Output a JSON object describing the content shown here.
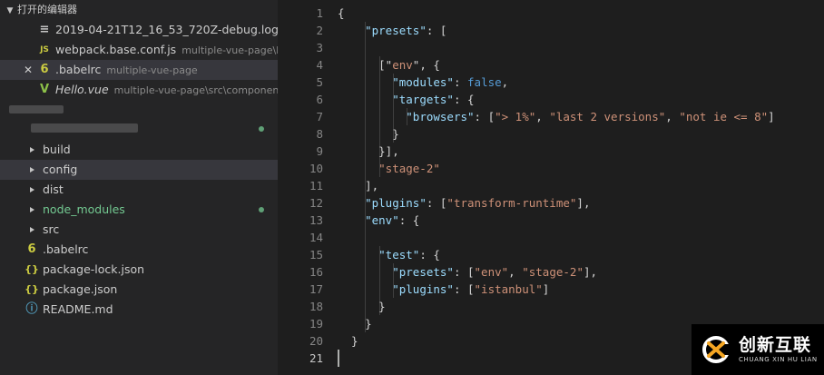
{
  "sidebar": {
    "open_editors_title": "打开的编辑器",
    "open_editors": [
      {
        "icon": "≡",
        "icon_color": "#c5c5c5",
        "name": "2019-04-21T12_16_53_720Z-debug.log",
        "desc": ""
      },
      {
        "icon": "JS",
        "icon_color": "#cbcb41",
        "name": "webpack.base.conf.js",
        "desc": "multiple-vue-page\\b..."
      },
      {
        "icon": "6",
        "icon_color": "#cbcb41",
        "name": ".babelrc",
        "desc": "multiple-vue-page",
        "close": "✕"
      },
      {
        "icon": "V",
        "icon_color": "#8dc149",
        "name": "Hello.vue",
        "desc": "multiple-vue-page\\src\\components"
      }
    ],
    "tree": [
      {
        "name": "build",
        "kind": "folder",
        "color": "#cccccc"
      },
      {
        "name": "config",
        "kind": "folder",
        "color": "#cccccc"
      },
      {
        "name": "dist",
        "kind": "folder",
        "color": "#cccccc"
      },
      {
        "name": "node_modules",
        "kind": "folder",
        "color": "#73c991"
      },
      {
        "name": "src",
        "kind": "folder",
        "color": "#cccccc"
      },
      {
        "name": ".babelrc",
        "kind": "file",
        "icon": "6",
        "icon_color": "#cbcb41",
        "color": "#cccccc"
      },
      {
        "name": "package-lock.json",
        "kind": "file",
        "icon": "{}",
        "icon_color": "#cbcb41",
        "color": "#cccccc"
      },
      {
        "name": "package.json",
        "kind": "file",
        "icon": "{}",
        "icon_color": "#cbcb41",
        "color": "#cccccc"
      },
      {
        "name": "README.md",
        "kind": "file",
        "icon": "ⓘ",
        "icon_color": "#519aba",
        "color": "#cccccc"
      }
    ]
  },
  "editor": {
    "line_numbers": [
      "1",
      "2",
      "3",
      "4",
      "5",
      "6",
      "7",
      "8",
      "9",
      "10",
      "11",
      "12",
      "13",
      "14",
      "15",
      "16",
      "17",
      "18",
      "19",
      "20",
      "21"
    ],
    "current_line": 21,
    "lines": [
      [
        [
          "p",
          "{"
        ]
      ],
      [
        [
          "p",
          "    "
        ],
        [
          "k",
          "\"presets\""
        ],
        [
          "p",
          ": ["
        ]
      ],
      [
        [
          "p",
          ""
        ]
      ],
      [
        [
          "p",
          "      [\""
        ],
        [
          "s",
          "env"
        ],
        [
          "p",
          "\", {"
        ]
      ],
      [
        [
          "p",
          "        "
        ],
        [
          "k",
          "\"modules\""
        ],
        [
          "p",
          ": "
        ],
        [
          "b",
          "false"
        ],
        [
          "p",
          ","
        ]
      ],
      [
        [
          "p",
          "        "
        ],
        [
          "k",
          "\"targets\""
        ],
        [
          "p",
          ": {"
        ]
      ],
      [
        [
          "p",
          "          "
        ],
        [
          "k",
          "\"browsers\""
        ],
        [
          "p",
          ": ["
        ],
        [
          "s",
          "\"> 1%\""
        ],
        [
          "p",
          ", "
        ],
        [
          "s",
          "\"last 2 versions\""
        ],
        [
          "p",
          ", "
        ],
        [
          "s",
          "\"not ie <= 8\""
        ],
        [
          "p",
          "]"
        ]
      ],
      [
        [
          "p",
          "        }"
        ]
      ],
      [
        [
          "p",
          "      }],"
        ]
      ],
      [
        [
          "p",
          "      "
        ],
        [
          "s",
          "\"stage-2\""
        ]
      ],
      [
        [
          "p",
          "    ],"
        ]
      ],
      [
        [
          "p",
          "    "
        ],
        [
          "k",
          "\"plugins\""
        ],
        [
          "p",
          ": ["
        ],
        [
          "s",
          "\"transform-runtime\""
        ],
        [
          "p",
          "],"
        ]
      ],
      [
        [
          "p",
          "    "
        ],
        [
          "k",
          "\"env\""
        ],
        [
          "p",
          ": {"
        ]
      ],
      [
        [
          "p",
          ""
        ]
      ],
      [
        [
          "p",
          "      "
        ],
        [
          "k",
          "\"test\""
        ],
        [
          "p",
          ": {"
        ]
      ],
      [
        [
          "p",
          "        "
        ],
        [
          "k",
          "\"presets\""
        ],
        [
          "p",
          ": ["
        ],
        [
          "s",
          "\"env\""
        ],
        [
          "p",
          ", "
        ],
        [
          "s",
          "\"stage-2\""
        ],
        [
          "p",
          "],"
        ]
      ],
      [
        [
          "p",
          "        "
        ],
        [
          "k",
          "\"plugins\""
        ],
        [
          "p",
          ": ["
        ],
        [
          "s",
          "\"istanbul\""
        ],
        [
          "p",
          "]"
        ]
      ],
      [
        [
          "p",
          "      }"
        ]
      ],
      [
        [
          "p",
          "    }"
        ]
      ],
      [
        [
          "p",
          "  }"
        ]
      ],
      [
        [
          "p",
          ""
        ]
      ]
    ]
  },
  "watermark": {
    "cn": "创新互联",
    "en": "CHUANG XIN HU LIAN",
    "brand_color": "#f5a623"
  }
}
